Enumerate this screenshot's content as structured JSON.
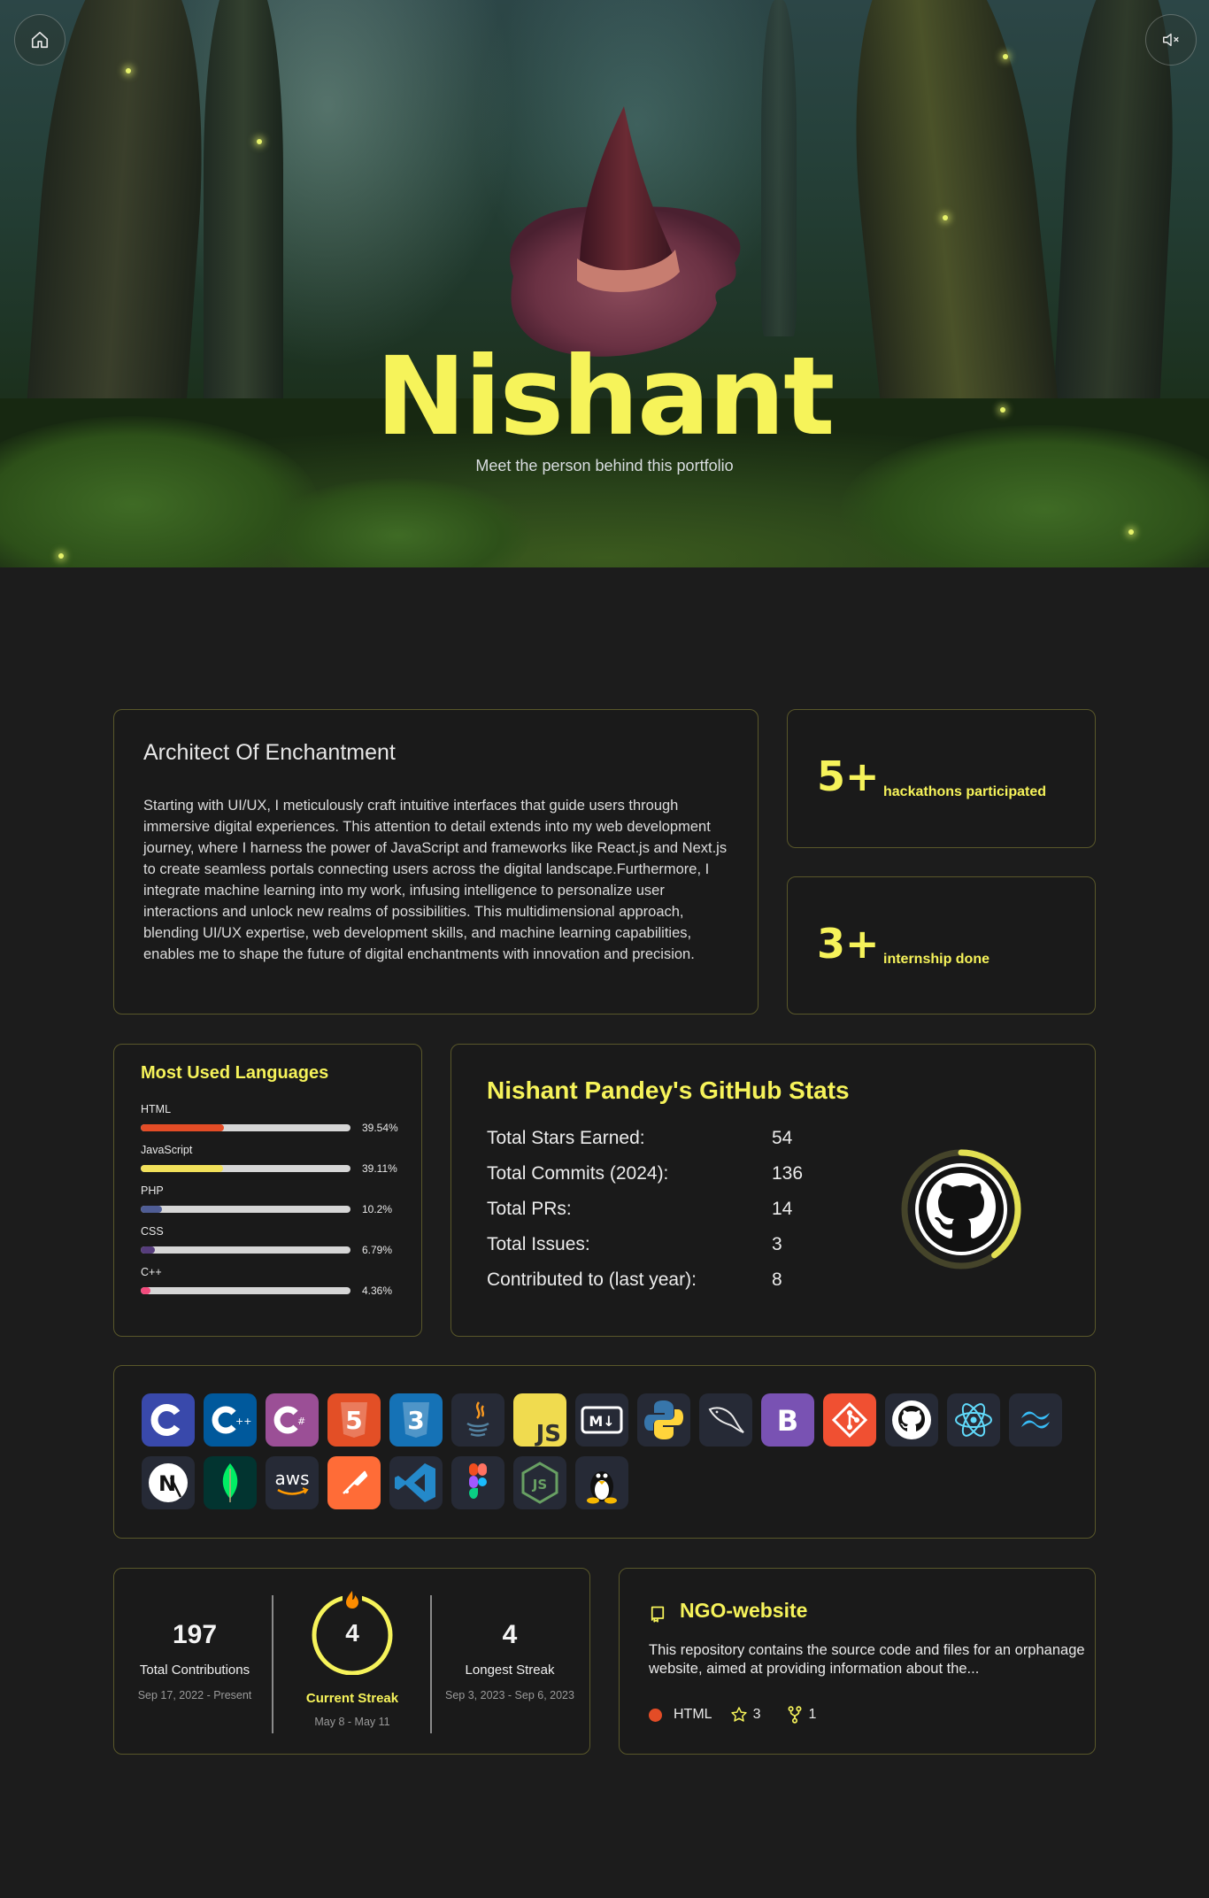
{
  "hero": {
    "title": "Nishant",
    "subtitle": "Meet the person behind this portfolio",
    "home_icon": "home-icon",
    "mute_icon": "speaker-muted-icon"
  },
  "about": {
    "title": "Architect Of Enchantment",
    "text": "Starting with UI/UX, I meticulously craft intuitive interfaces that guide users through immersive digital experiences. This attention to detail extends into my web development journey, where I harness the power of JavaScript and frameworks like React.js and Next.js to create seamless portals connecting users across the digital landscape.Furthermore, I integrate machine learning into my work, infusing intelligence to personalize user interactions and unlock new realms of possibilities. This multidimensional approach, blending UI/UX expertise, web development skills, and machine learning capabilities, enables me to shape the future of digital enchantments with innovation and precision."
  },
  "stats": [
    {
      "value": "5+",
      "label": "hackathons participated"
    },
    {
      "value": "3+",
      "label": "internship done"
    }
  ],
  "languages": {
    "title": "Most Used Languages",
    "items": [
      {
        "name": "HTML",
        "percent": "39.54%",
        "fraction": 0.3954,
        "color": "#e34c26"
      },
      {
        "name": "JavaScript",
        "percent": "39.11%",
        "fraction": 0.3911,
        "color": "#f1e05a"
      },
      {
        "name": "PHP",
        "percent": "10.2%",
        "fraction": 0.102,
        "color": "#4f5d95"
      },
      {
        "name": "CSS",
        "percent": "6.79%",
        "fraction": 0.0679,
        "color": "#563d7c"
      },
      {
        "name": "C++",
        "percent": "4.36%",
        "fraction": 0.0436,
        "color": "#f34b7d"
      }
    ]
  },
  "github": {
    "title": "Nishant Pandey's GitHub Stats",
    "rows": [
      {
        "label": "Total Stars Earned:",
        "value": "54"
      },
      {
        "label": "Total Commits (2024):",
        "value": "136"
      },
      {
        "label": "Total PRs:",
        "value": "14"
      },
      {
        "label": "Total Issues:",
        "value": "3"
      },
      {
        "label": "Contributed to (last year):",
        "value": "8"
      }
    ],
    "ring_fraction": 0.4
  },
  "tech_stack": [
    "c-icon",
    "cplusplus-icon",
    "csharp-icon",
    "html5-icon",
    "css3-icon",
    "java-icon",
    "javascript-icon",
    "markdown-icon",
    "python-icon",
    "mysql-icon",
    "bootstrap-icon",
    "git-icon",
    "github-icon",
    "react-icon",
    "tailwind-icon",
    "nextjs-icon",
    "mongodb-icon",
    "aws-icon",
    "postman-icon",
    "vscode-icon",
    "figma-icon",
    "nodejs-icon",
    "linux-icon"
  ],
  "tech_text": {
    "html5": "5",
    "css3": "3",
    "js": "JS",
    "md": "M↓",
    "bootstrap": "B",
    "next": "N",
    "aws": "aws",
    "node": "JS"
  },
  "streak": {
    "total": "197",
    "total_label": "Total Contributions",
    "total_range": "Sep 17, 2022 - Present",
    "current": "4",
    "current_label": "Current Streak",
    "current_range": "May 8 - May 11",
    "longest": "4",
    "longest_label": "Longest Streak",
    "longest_range": "Sep 3, 2023 - Sep 6, 2023"
  },
  "repo": {
    "name": "NGO-website",
    "description": "This repository contains the source code and files for an orphanage website, aimed at providing information about the...",
    "language": "HTML",
    "language_color": "#e34c26",
    "stars": "3",
    "forks": "1"
  },
  "colors": {
    "accent": "#f6f35a",
    "background": "#1c1c1c",
    "card_border": "#59572a"
  }
}
